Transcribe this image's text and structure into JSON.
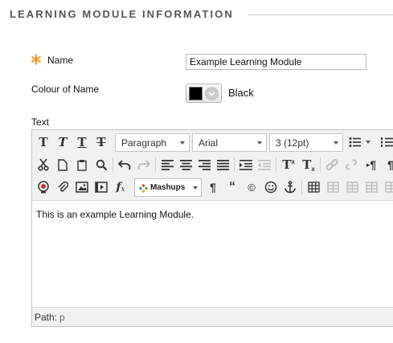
{
  "section": {
    "title": "LEARNING MODULE INFORMATION"
  },
  "form": {
    "name": {
      "label": "Name",
      "value": "Example Learning Module",
      "required": true
    },
    "colour": {
      "label": "Colour of Name",
      "value": "Black",
      "swatch": "#000000"
    },
    "text": {
      "label": "Text"
    }
  },
  "editor": {
    "toolbar": {
      "paragraph": "Paragraph",
      "font": "Arial",
      "size": "3 (12pt)",
      "mashups": "Mashups"
    },
    "content": "This is an example Learning Module.",
    "path": {
      "label": "Path:",
      "value": "p"
    }
  },
  "colors": {
    "required": "#f39c2b",
    "header_text": "#555555",
    "toolbar_bg": "#f1f1f1"
  }
}
